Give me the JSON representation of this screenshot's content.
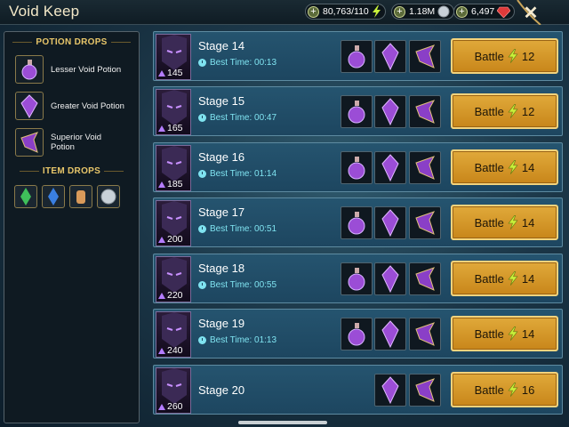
{
  "header": {
    "title": "Void Keep",
    "energy": "80,763/110",
    "silver": "1.18M",
    "gems": "6,497"
  },
  "sidebar": {
    "potion_drops_title": "POTION DROPS",
    "potions": [
      {
        "name": "Lesser Void Potion"
      },
      {
        "name": "Greater Void Potion"
      },
      {
        "name": "Superior Void Potion"
      }
    ],
    "item_drops_title": "ITEM DROPS"
  },
  "stages": [
    {
      "name": "Stage 14",
      "level": "145",
      "best_time_label": "Best Time:",
      "best_time": "00:13",
      "battle_label": "Battle",
      "cost": "12",
      "drops": 3
    },
    {
      "name": "Stage 15",
      "level": "165",
      "best_time_label": "Best Time:",
      "best_time": "00:47",
      "battle_label": "Battle",
      "cost": "12",
      "drops": 3
    },
    {
      "name": "Stage 16",
      "level": "185",
      "best_time_label": "Best Time:",
      "best_time": "01:14",
      "battle_label": "Battle",
      "cost": "14",
      "drops": 3
    },
    {
      "name": "Stage 17",
      "level": "200",
      "best_time_label": "Best Time:",
      "best_time": "00:51",
      "battle_label": "Battle",
      "cost": "14",
      "drops": 3
    },
    {
      "name": "Stage 18",
      "level": "220",
      "best_time_label": "Best Time:",
      "best_time": "00:55",
      "battle_label": "Battle",
      "cost": "14",
      "drops": 3
    },
    {
      "name": "Stage 19",
      "level": "240",
      "best_time_label": "Best Time:",
      "best_time": "01:13",
      "battle_label": "Battle",
      "cost": "14",
      "drops": 3
    },
    {
      "name": "Stage 20",
      "level": "260",
      "best_time_label": "",
      "best_time": "",
      "battle_label": "Battle",
      "cost": "16",
      "drops": 2
    }
  ],
  "colors": {
    "accent_gold": "#e0a93a",
    "best_time": "#7fe3f0",
    "potion_purple": "#9b4dd6"
  }
}
